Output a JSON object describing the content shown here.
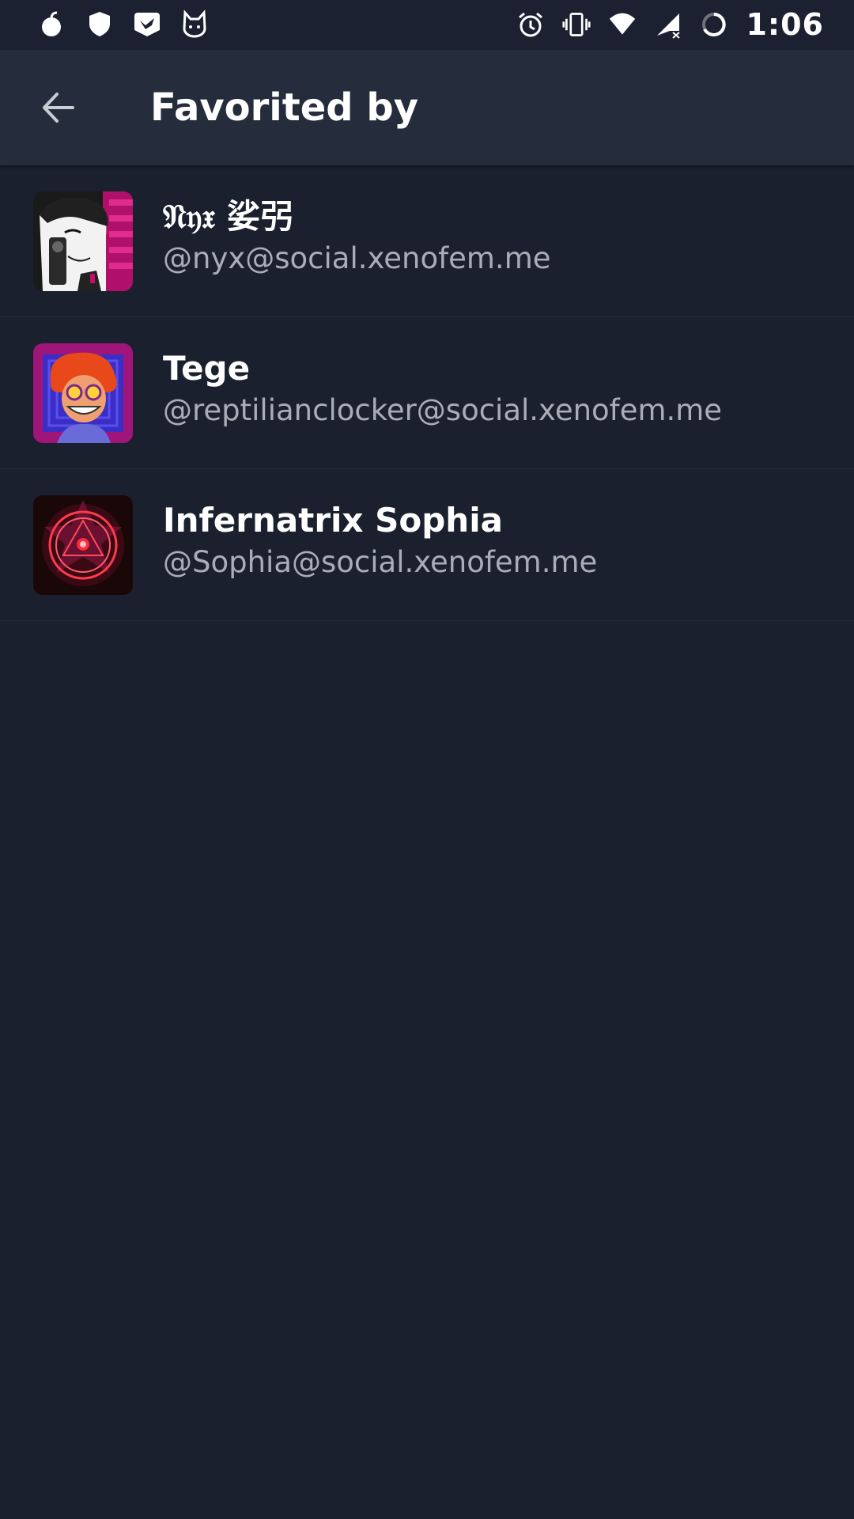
{
  "status_bar": {
    "time": "1:06",
    "left_icons": [
      "bomb-icon",
      "shield-icon",
      "bird-icon",
      "cat-icon"
    ],
    "right_icons": [
      "alarm-icon",
      "vibrate-icon",
      "wifi-icon",
      "signal-icon",
      "battery-charging-icon"
    ]
  },
  "app_bar": {
    "title": "Favorited by",
    "back_icon": "arrow-back-icon"
  },
  "accounts": [
    {
      "display_name": "𝔑𝔶𝔵 娑弜",
      "handle": "@nyx@social.xenofem.me"
    },
    {
      "display_name": "Tege",
      "handle": "@reptilianclocker@social.xenofem.me"
    },
    {
      "display_name": "Infernatrix Sophia",
      "handle": "@Sophia@social.xenofem.me"
    }
  ],
  "colors": {
    "background": "#1a202e",
    "app_bar": "#252c3b",
    "status_bar": "#1b2131",
    "primary_text": "#ffffff",
    "secondary_text": "#a8adb6"
  }
}
